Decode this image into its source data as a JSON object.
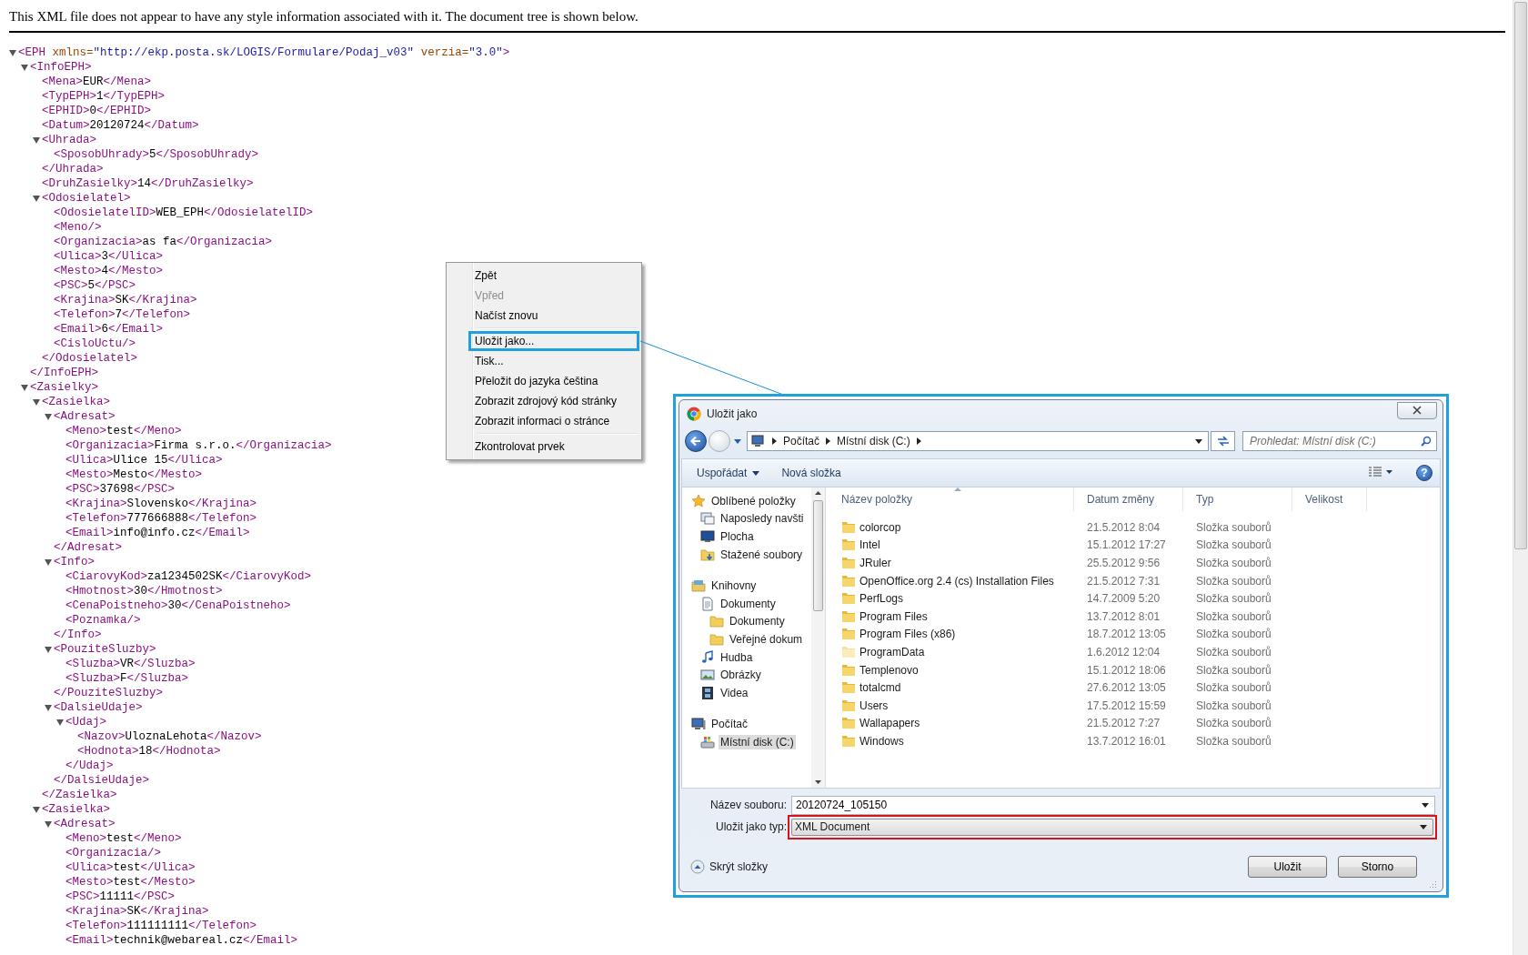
{
  "notice": "This XML file does not appear to have any style information associated with it. The document tree is shown below.",
  "xml_tree": {
    "open": "<EPH",
    "attributes": [
      {
        "name": "xmlns=",
        "value": "\"http://ekp.posta.sk/LOGIS/Formulare/Podaj_v03\""
      },
      {
        "name": "verzia=",
        "value": "\"3.0\""
      }
    ],
    "open_end": ">",
    "expanded": true,
    "children": [
      {
        "open": "<InfoEPH>",
        "expanded": true,
        "close": "</InfoEPH>",
        "children": [
          {
            "open": "<Mena>",
            "value": "EUR",
            "close": "</Mena>"
          },
          {
            "open": "<TypEPH>",
            "value": "1",
            "close": "</TypEPH>"
          },
          {
            "open": "<EPHID>",
            "value": "0",
            "close": "</EPHID>"
          },
          {
            "open": "<Datum>",
            "value": "20120724",
            "close": "</Datum>"
          },
          {
            "open": "<Uhrada>",
            "expanded": true,
            "close": "</Uhrada>",
            "children": [
              {
                "open": "<SposobUhrady>",
                "value": "5",
                "close": "</SposobUhrady>"
              }
            ]
          },
          {
            "open": "<DruhZasielky>",
            "value": "14",
            "close": "</DruhZasielky>"
          },
          {
            "open": "<Odosielatel>",
            "expanded": true,
            "close": "</Odosielatel>",
            "children": [
              {
                "open": "<OdosielatelID>",
                "value": "WEB_EPH",
                "close": "</OdosielatelID>"
              },
              {
                "open": "<Meno/>"
              },
              {
                "open": "<Organizacia>",
                "value": "as fa",
                "close": "</Organizacia>"
              },
              {
                "open": "<Ulica>",
                "value": "3",
                "close": "</Ulica>"
              },
              {
                "open": "<Mesto>",
                "value": "4",
                "close": "</Mesto>"
              },
              {
                "open": "<PSC>",
                "value": "5",
                "close": "</PSC>"
              },
              {
                "open": "<Krajina>",
                "value": "SK",
                "close": "</Krajina>"
              },
              {
                "open": "<Telefon>",
                "value": "7",
                "close": "</Telefon>"
              },
              {
                "open": "<Email>",
                "value": "6",
                "close": "</Email>"
              },
              {
                "open": "<CisloUctu/>"
              }
            ]
          }
        ]
      },
      {
        "open": "<Zasielky>",
        "expanded": true,
        "children": [
          {
            "open": "<Zasielka>",
            "expanded": true,
            "close": "</Zasielka>",
            "children": [
              {
                "open": "<Adresat>",
                "expanded": true,
                "close": "</Adresat>",
                "children": [
                  {
                    "open": "<Meno>",
                    "value": "test",
                    "close": "</Meno>"
                  },
                  {
                    "open": "<Organizacia>",
                    "value": "Firma s.r.o.",
                    "close": "</Organizacia>"
                  },
                  {
                    "open": "<Ulica>",
                    "value": "Ulice 15",
                    "close": "</Ulica>"
                  },
                  {
                    "open": "<Mesto>",
                    "value": "Mesto",
                    "close": "</Mesto>"
                  },
                  {
                    "open": "<PSC>",
                    "value": "37698",
                    "close": "</PSC>"
                  },
                  {
                    "open": "<Krajina>",
                    "value": "Slovensko",
                    "close": "</Krajina>"
                  },
                  {
                    "open": "<Telefon>",
                    "value": "777666888",
                    "close": "</Telefon>"
                  },
                  {
                    "open": "<Email>",
                    "value": "info@info.cz",
                    "close": "</Email>"
                  }
                ]
              },
              {
                "open": "<Info>",
                "expanded": true,
                "close": "</Info>",
                "children": [
                  {
                    "open": "<CiarovyKod>",
                    "value": "za1234502SK",
                    "close": "</CiarovyKod>"
                  },
                  {
                    "open": "<Hmotnost>",
                    "value": "30",
                    "close": "</Hmotnost>"
                  },
                  {
                    "open": "<CenaPoistneho>",
                    "value": "30",
                    "close": "</CenaPoistneho>"
                  },
                  {
                    "open": "<Poznamka/>"
                  }
                ]
              },
              {
                "open": "<PouziteSluzby>",
                "expanded": true,
                "close": "</PouziteSluzby>",
                "children": [
                  {
                    "open": "<Sluzba>",
                    "value": "VR",
                    "close": "</Sluzba>"
                  },
                  {
                    "open": "<Sluzba>",
                    "value": "F",
                    "close": "</Sluzba>"
                  }
                ]
              },
              {
                "open": "<DalsieUdaje>",
                "expanded": true,
                "close": "</DalsieUdaje>",
                "children": [
                  {
                    "open": "<Udaj>",
                    "expanded": true,
                    "close": "</Udaj>",
                    "children": [
                      {
                        "open": "<Nazov>",
                        "value": "UloznaLehota",
                        "close": "</Nazov>"
                      },
                      {
                        "open": "<Hodnota>",
                        "value": "18",
                        "close": "</Hodnota>"
                      }
                    ]
                  }
                ]
              }
            ]
          },
          {
            "open": "<Zasielka>",
            "expanded": true,
            "children": [
              {
                "open": "<Adresat>",
                "expanded": true,
                "children": [
                  {
                    "open": "<Meno>",
                    "value": "test",
                    "close": "</Meno>"
                  },
                  {
                    "open": "<Organizacia/>"
                  },
                  {
                    "open": "<Ulica>",
                    "value": "test",
                    "close": "</Ulica>"
                  },
                  {
                    "open": "<Mesto>",
                    "value": "test",
                    "close": "</Mesto>"
                  },
                  {
                    "open": "<PSC>",
                    "value": "11111",
                    "close": "</PSC>"
                  },
                  {
                    "open": "<Krajina>",
                    "value": "SK",
                    "close": "</Krajina>"
                  },
                  {
                    "open": "<Telefon>",
                    "value": "111111111",
                    "close": "</Telefon>"
                  },
                  {
                    "open": "<Email>",
                    "value": "technik@webareal.cz",
                    "close": "</Email>"
                  }
                ]
              }
            ]
          }
        ]
      }
    ]
  },
  "context_menu": {
    "groups": [
      {
        "items": [
          {
            "label": "Zpět",
            "disabled": false,
            "highlighted": false
          },
          {
            "label": "Vpřed",
            "disabled": true,
            "highlighted": false
          },
          {
            "label": "Načíst znovu",
            "disabled": false,
            "highlighted": false
          }
        ]
      },
      {
        "items": [
          {
            "label": "Uložit jako...",
            "disabled": false,
            "highlighted": true
          },
          {
            "label": "Tisk...",
            "disabled": false,
            "highlighted": false
          },
          {
            "label": "Přeložit do jazyka čeština",
            "disabled": false,
            "highlighted": false
          },
          {
            "label": "Zobrazit zdrojový kód stránky",
            "disabled": false,
            "highlighted": false
          },
          {
            "label": "Zobrazit informaci o stránce",
            "disabled": false,
            "highlighted": false
          }
        ]
      },
      {
        "items": [
          {
            "label": "Zkontrolovat prvek",
            "disabled": false,
            "highlighted": false
          }
        ]
      }
    ]
  },
  "save_dialog": {
    "title": "Uložit jako",
    "highlighted": true,
    "address": {
      "parts": [
        "Počítač",
        "Místní disk (C:)"
      ]
    },
    "search": {
      "placeholder": "Prohledat: Místní disk (C:)"
    },
    "toolbar": [
      {
        "label": "Uspořádat",
        "kind": "menu"
      },
      {
        "label": "Nová složka",
        "kind": "button"
      }
    ],
    "help_button": "?",
    "nav_pane": [
      {
        "label": "Oblíbené položky",
        "kind": "star",
        "selected": false,
        "children": [
          {
            "label": "Naposledy navšti",
            "kind": "recent",
            "selected": false
          },
          {
            "label": "Plocha",
            "kind": "desktop",
            "selected": false
          },
          {
            "label": "Stažené soubory",
            "kind": "download",
            "selected": false
          }
        ]
      },
      {
        "label": "Knihovny",
        "kind": "library",
        "selected": false,
        "children": [
          {
            "label": "Dokumenty",
            "kind": "document",
            "selected": false,
            "children": [
              {
                "label": "Dokumenty",
                "kind": "folder",
                "selected": false
              },
              {
                "label": "Veřejné dokum",
                "kind": "folder",
                "selected": false
              }
            ]
          },
          {
            "label": "Hudba",
            "kind": "music",
            "selected": false
          },
          {
            "label": "Obrázky",
            "kind": "pictures",
            "selected": false
          },
          {
            "label": "Videa",
            "kind": "video",
            "selected": false
          }
        ]
      },
      {
        "label": "Počítač",
        "kind": "computer",
        "selected": false,
        "children": [
          {
            "label": "Místní disk (C:)",
            "kind": "drive",
            "selected": true
          }
        ]
      }
    ],
    "columns": [
      "Název položky",
      "Datum změny",
      "Typ",
      "Velikost"
    ],
    "rows": [
      {
        "name": "colorcop",
        "date": "21.5.2012 8:04",
        "type": "Složka souborů",
        "hidden": false
      },
      {
        "name": "Intel",
        "date": "15.1.2012 17:27",
        "type": "Složka souborů",
        "hidden": false
      },
      {
        "name": "JRuler",
        "date": "25.5.2012 9:56",
        "type": "Složka souborů",
        "hidden": false
      },
      {
        "name": "OpenOffice.org 2.4 (cs) Installation Files",
        "date": "21.5.2012 7:31",
        "type": "Složka souborů",
        "hidden": false
      },
      {
        "name": "PerfLogs",
        "date": "14.7.2009 5:20",
        "type": "Složka souborů",
        "hidden": false
      },
      {
        "name": "Program Files",
        "date": "13.7.2012 8:01",
        "type": "Složka souborů",
        "hidden": false
      },
      {
        "name": "Program Files (x86)",
        "date": "18.7.2012 13:05",
        "type": "Složka souborů",
        "hidden": false
      },
      {
        "name": "ProgramData",
        "date": "1.6.2012 12:04",
        "type": "Složka souborů",
        "hidden": true
      },
      {
        "name": "Templenovo",
        "date": "15.1.2012 18:06",
        "type": "Složka souborů",
        "hidden": false
      },
      {
        "name": "totalcmd",
        "date": "27.6.2012 13:05",
        "type": "Složka souborů",
        "hidden": false
      },
      {
        "name": "Users",
        "date": "17.5.2012 15:59",
        "type": "Složka souborů",
        "hidden": false
      },
      {
        "name": "Wallapapers",
        "date": "21.5.2012 7:27",
        "type": "Složka souborů",
        "hidden": false
      },
      {
        "name": "Windows",
        "date": "13.7.2012 16:01",
        "type": "Složka souborů",
        "hidden": false
      }
    ],
    "filename": {
      "label": "Název souboru:",
      "value": "20120724_105150"
    },
    "filetype": {
      "label": "Uložit jako typ:",
      "value": "XML Document",
      "highlighted": true
    },
    "hide_folders": "Skrýt složky",
    "buttons": [
      "Uložit",
      "Storno"
    ]
  }
}
